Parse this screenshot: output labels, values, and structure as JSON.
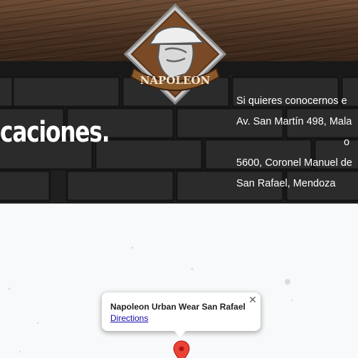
{
  "header": {
    "logo_text": "NAPOLEON"
  },
  "hero": {
    "headline": "caciones.",
    "locations": {
      "intro": "Si quieres conocernos e",
      "address1": "Av. San Martín 498, Mala",
      "separator": "o",
      "address2": "5600, Coronel Manuel de",
      "address3": "San Rafael, Mendoza"
    }
  },
  "map": {
    "infowindow": {
      "place_name": "Napoleon Urban Wear San Rafael",
      "directions_label": "Directions",
      "close_glyph": "✕"
    },
    "marker_color": "#ea4335"
  },
  "colors": {
    "wood": "#4a3222",
    "brick": "#1f1f1f",
    "map_bg": "#f8f9fa",
    "link": "#1a0dab"
  }
}
